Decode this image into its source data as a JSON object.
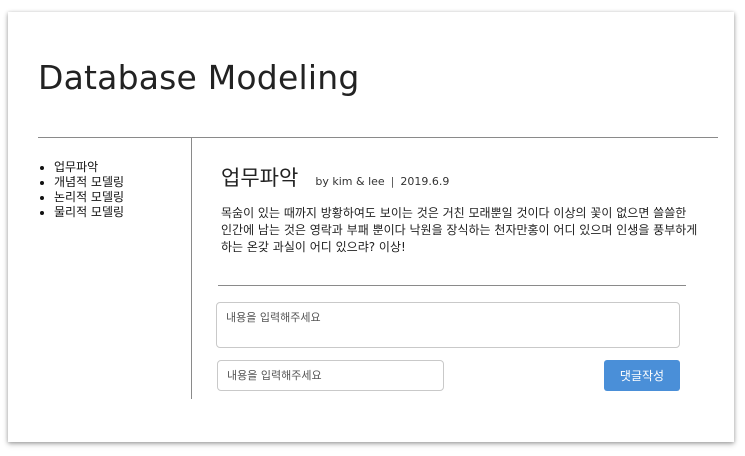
{
  "header": {
    "title": "Database Modeling"
  },
  "sidebar": {
    "items": [
      {
        "label": "업무파악"
      },
      {
        "label": "개념적 모델링"
      },
      {
        "label": "논리적 모델링"
      },
      {
        "label": "물리적 모델링"
      }
    ]
  },
  "post": {
    "title": "업무파악",
    "author": "by kim & lee",
    "separator": "|",
    "date": "2019.6.9",
    "body": "목숨이 있는 때까지 방황하여도 보이는 것은 거친 모래뿐일 것이다 이상의 꽃이 없으면 쓸쓸한 인간에 남는 것은 영락과 부패 뿐이다 낙원을 장식하는 천자만홍이 어디 있으며 인생을 풍부하게 하는 온갖 과실이 어디 있으랴? 이상!"
  },
  "comment_form": {
    "content_placeholder": "내용을 입력해주세요",
    "name_placeholder": "내용을 입력해주세요",
    "submit_label": "댓글작성"
  }
}
